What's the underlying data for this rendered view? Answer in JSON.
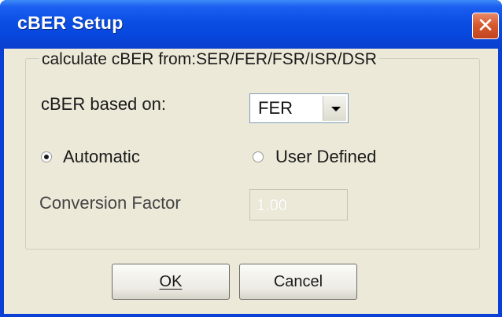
{
  "window": {
    "title": "cBER Setup",
    "close_icon": "close-icon"
  },
  "group": {
    "legend": "calculate cBER from:SER/FER/FSR/ISR/DSR"
  },
  "based_on": {
    "label": "cBER based on:",
    "selected": "FER"
  },
  "mode": {
    "automatic_label": "Automatic",
    "user_defined_label": "User Defined",
    "selected": "Automatic"
  },
  "conversion": {
    "label": "Conversion Factor",
    "value": "1.00"
  },
  "buttons": {
    "ok": "OK",
    "cancel": "Cancel"
  },
  "colors": {
    "title_bar": "#0a4ee4",
    "client": "#ece9d8",
    "close": "#d65a30"
  }
}
